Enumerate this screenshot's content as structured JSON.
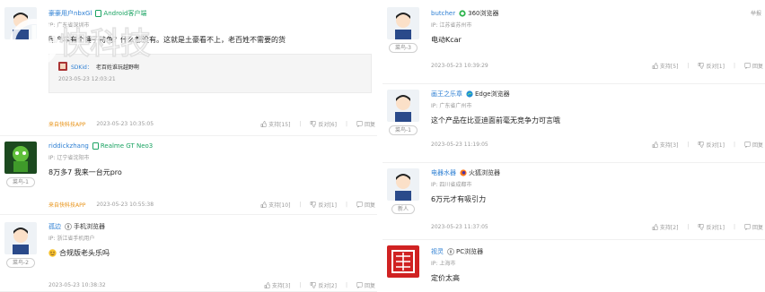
{
  "left": [
    {
      "username": "豪豪用户nbxGl",
      "device": "Android客户端",
      "device_color": "#1aa362",
      "ip": "IP: 广东省深圳市",
      "text": "国产车有个锤子特色？什么都没有。这就是土豪看不上，老百姓不需要的货",
      "reply": {
        "name": "SDKid：",
        "text": "老百姓谁玩越野啊",
        "time": "2023-05-23 12:03:21"
      },
      "source": "来自快科技APP",
      "time": "2023-05-23 10:35:05",
      "support": "支持[15]",
      "oppose": "反对[6]",
      "reply_label": "回复"
    },
    {
      "username": "riddickzhang",
      "device": "Realme GT Neo3",
      "device_color": "#1aa362",
      "ip": "IP: 辽宁省沈阳市",
      "text": "8万多7  我来一台元pro",
      "rank": "菜鸟-1",
      "source": "来自快科技APP",
      "time": "2023-05-23 10:55:38",
      "support": "支持[10]",
      "oppose": "反对[1]",
      "reply_label": "回复"
    },
    {
      "username": "孤边",
      "device": "手机浏览器",
      "ip": "IP: 浙江省手机用户",
      "text": "合规版老头乐吗",
      "rank": "菜鸟-2",
      "time": "2023-05-23 10:38:32",
      "support": "支持[3]",
      "oppose": "反对[2]",
      "reply_label": "回复"
    }
  ],
  "right": [
    {
      "username": "butcher",
      "device": "360浏览器",
      "ip": "IP: 江苏省苏州市",
      "text": "电动Kcar",
      "rank": "菜鸟-3",
      "time": "2023-05-23 10:39:29",
      "support": "支持[5]",
      "oppose": "反对[1]",
      "reply_label": "回复",
      "top_tag": "举报"
    },
    {
      "username": "画王之乐章",
      "device": "Edge浏览器",
      "ip": "IP: 广东省广州市",
      "text": "这个产品在比亚迪面前毫无竞争力可言哦",
      "rank": "菜鸟-1",
      "time": "2023-05-23 11:19:05",
      "support": "支持[3]",
      "oppose": "反对[1]",
      "reply_label": "回复"
    },
    {
      "username": "电器水器",
      "device": "火狐浏览器",
      "ip": "IP: 四川省成都市",
      "text": "6万元才有吸引力",
      "rank": "新人",
      "time": "2023-05-23 11:37:05",
      "support": "支持[2]",
      "oppose": "反对[1]",
      "reply_label": "回复"
    },
    {
      "username": "视灵",
      "device": "PC浏览器",
      "ip": "IP: 上海市",
      "text": "定价太高"
    }
  ],
  "watermark": {
    "text": "快科技"
  }
}
